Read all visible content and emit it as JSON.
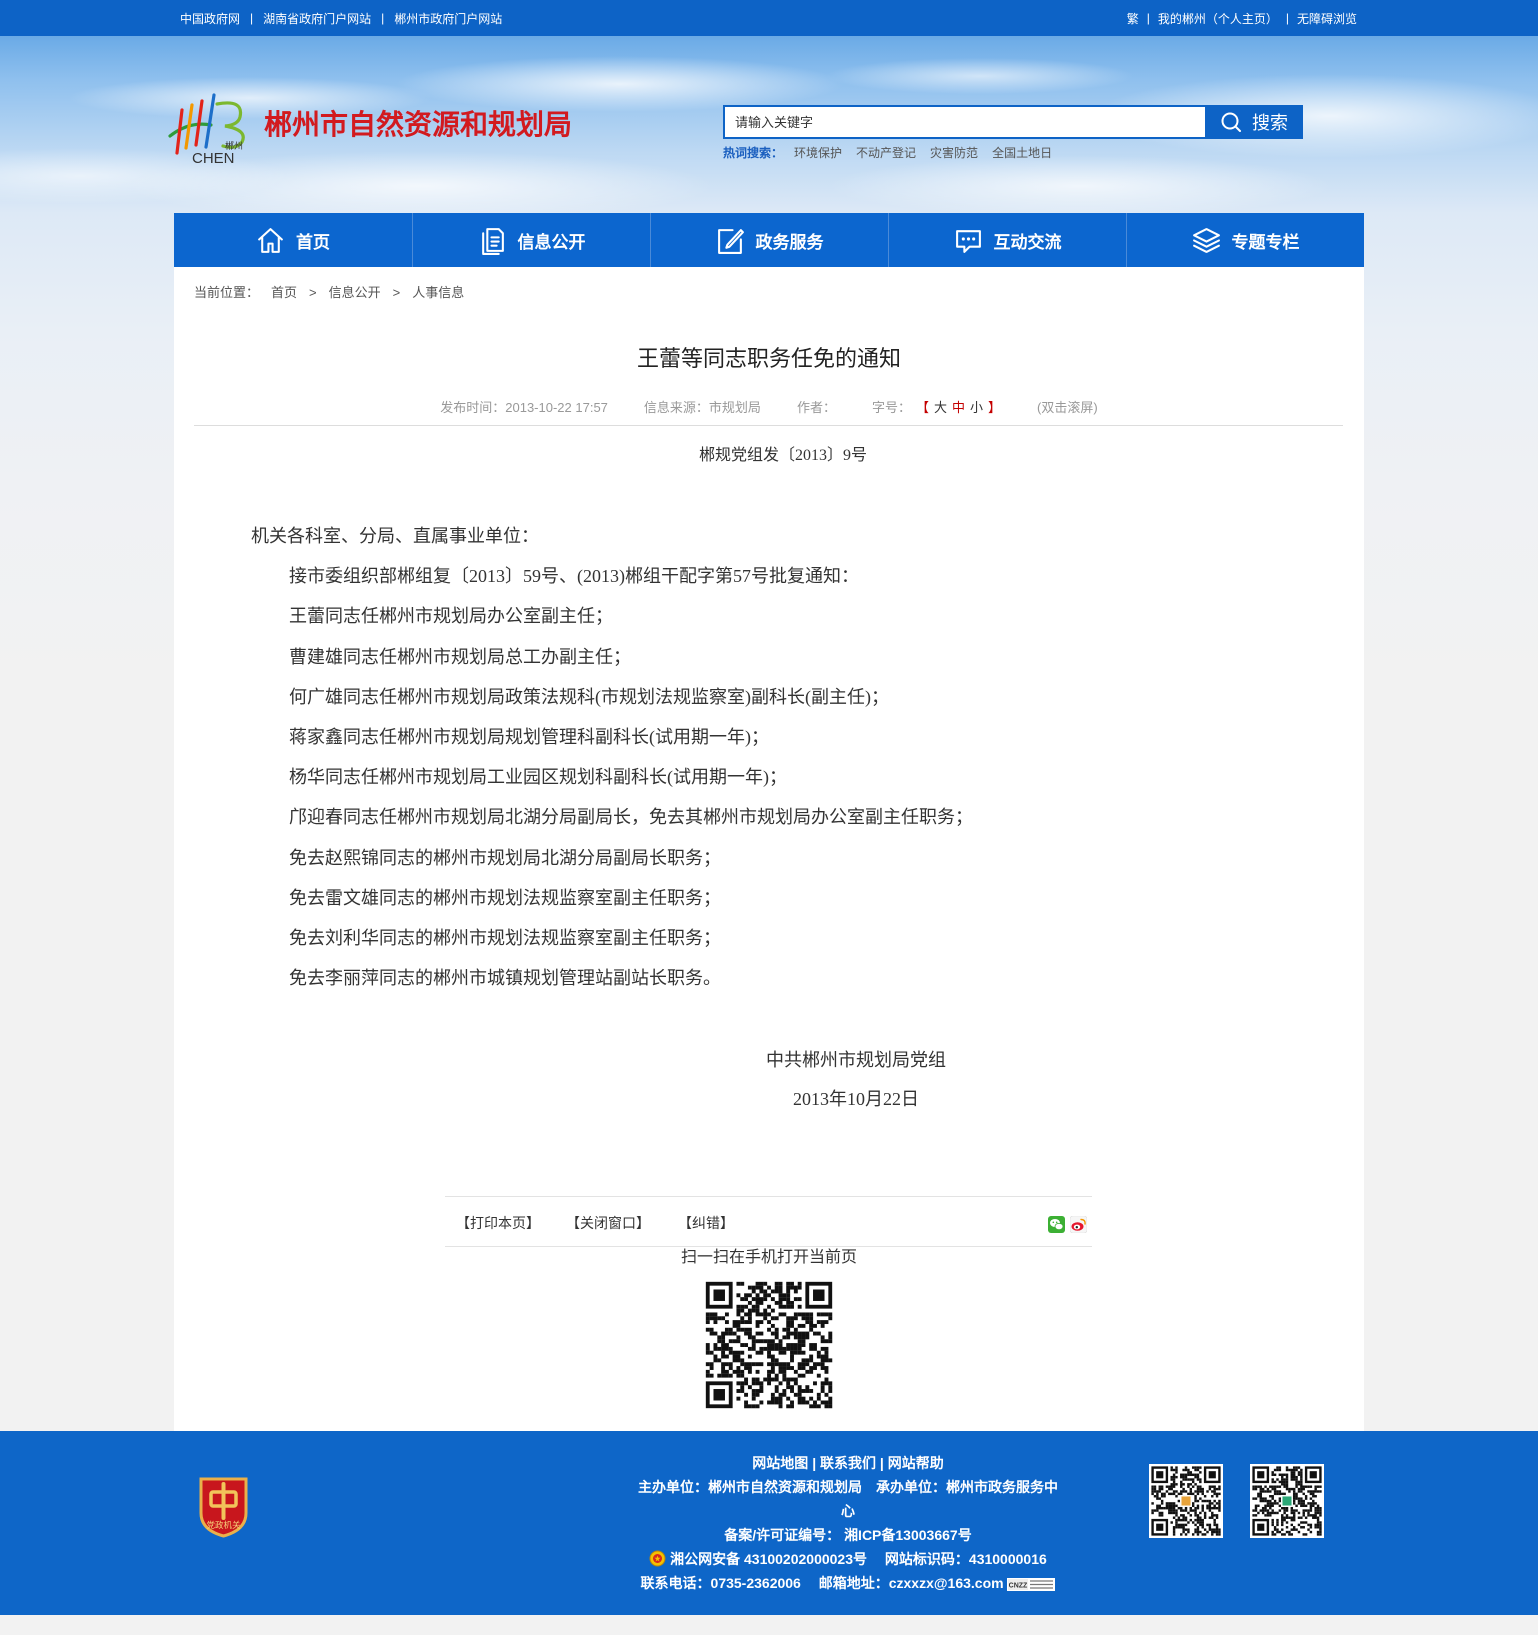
{
  "colors": {
    "primary": "#0d63c6",
    "nav": "#0c66cf",
    "title_red": "#d21a1f",
    "footer": "#0e66c8"
  },
  "topbar": {
    "separator": "|",
    "left_links": [
      "中国政府网",
      "湖南省政府门户网站",
      "郴州市政府门户网站"
    ],
    "right_links": [
      "繁",
      "我的郴州（个人主页）",
      "无障碍浏览"
    ]
  },
  "header": {
    "logo": {
      "cn": "郴州",
      "en": "CHEN"
    },
    "site_title": "郴州市自然资源和规划局",
    "search": {
      "placeholder": "请输入关键字",
      "button_label": "搜索",
      "icon": "search-icon"
    },
    "hot_search": {
      "label": "热词搜索：",
      "items": [
        "环境保护",
        "不动产登记",
        "灾害防范",
        "全国土地日"
      ]
    }
  },
  "nav": {
    "items": [
      {
        "label": "首页",
        "icon": "home-icon"
      },
      {
        "label": "信息公开",
        "icon": "document-icon"
      },
      {
        "label": "政务服务",
        "icon": "edit-icon"
      },
      {
        "label": "互动交流",
        "icon": "chat-icon"
      },
      {
        "label": "专题专栏",
        "icon": "layers-icon"
      }
    ]
  },
  "breadcrumb": {
    "label": "当前位置：",
    "separator": ">",
    "items": [
      "首页",
      "信息公开",
      "人事信息"
    ]
  },
  "article": {
    "title": "王蕾等同志职务任免的通知",
    "meta": {
      "publish_time": "发布时间：2013-10-22 17:57",
      "source": "信息来源：市规划局",
      "author": "作者：",
      "font_size_label": "字号：",
      "bracket_open": "【",
      "sizes": [
        "大",
        "中",
        "小"
      ],
      "bracket_close": "】",
      "scroll_hint": "(双击滚屏)"
    },
    "doc_number": "郴规党组发〔2013〕9号",
    "salutation": "机关各科室、分局、直属事业单位：",
    "paragraphs": [
      "接市委组织部郴组复〔2013〕59号、(2013)郴组干配字第57号批复通知：",
      "王蕾同志任郴州市规划局办公室副主任；",
      "曹建雄同志任郴州市规划局总工办副主任；",
      "何广雄同志任郴州市规划局政策法规科(市规划法规监察室)副科长(副主任)；",
      "蒋家鑫同志任郴州市规划局规划管理科副科长(试用期一年)；",
      "杨华同志任郴州市规划局工业园区规划科副科长(试用期一年)；",
      "邝迎春同志任郴州市规划局北湖分局副局长，免去其郴州市规划局办公室副主任职务；",
      "免去赵熙锦同志的郴州市规划局北湖分局副局长职务；",
      "免去雷文雄同志的郴州市规划法规监察室副主任职务；",
      "免去刘利华同志的郴州市规划法规监察室副主任职务；",
      "免去李丽萍同志的郴州市城镇规划管理站副站长职务。"
    ],
    "signature": {
      "org": "中共郴州市规划局党组",
      "date": "2013年10月22日"
    }
  },
  "tools": {
    "print": "【打印本页】",
    "close": "【关闭窗口】",
    "correct": "【纠错】",
    "share_icons": [
      "wechat-icon",
      "weibo-icon"
    ]
  },
  "qr": {
    "caption": "扫一扫在手机打开当前页"
  },
  "footer": {
    "badge": "党政机关",
    "separator": "|",
    "links": [
      "网站地图",
      "联系我们",
      "网站帮助"
    ],
    "sponsor": "主办单位：郴州市自然资源和规划局",
    "organizer": "承办单位：郴州市政务服务中心",
    "icp_label": "备案/许可证编号：",
    "icp": "湘ICP备13003667号",
    "police": "湘公网安备 43100202000023号",
    "site_code": "网站标识码：4310000016",
    "phone": "联系电话：0735-2362006",
    "email": "邮箱地址：czxxzx@163.com",
    "cnzz": "CNZZ"
  }
}
